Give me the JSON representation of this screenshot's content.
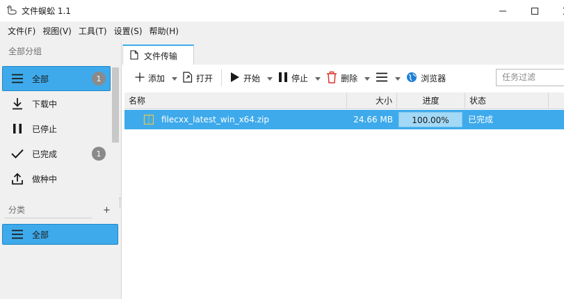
{
  "window": {
    "title": "文件蜈蚣 1.1"
  },
  "menu": [
    "文件(F)",
    "视图(V)",
    "工具(T)",
    "设置(S)",
    "帮助(H)"
  ],
  "sidebar": {
    "group_label": "全部分组",
    "items": [
      {
        "label": "全部",
        "icon": "list-icon",
        "badge": "1",
        "active": true
      },
      {
        "label": "下载中",
        "icon": "download-icon",
        "badge": "",
        "active": false
      },
      {
        "label": "已停止",
        "icon": "pause-icon",
        "badge": "",
        "active": false
      },
      {
        "label": "已完成",
        "icon": "check-icon",
        "badge": "1",
        "active": false
      },
      {
        "label": "做种中",
        "icon": "upload-icon",
        "badge": "",
        "active": false
      }
    ],
    "category_label": "分类",
    "category_add": "+",
    "categories": [
      {
        "label": "全部",
        "icon": "list-icon",
        "active": true
      }
    ]
  },
  "tabs": [
    {
      "label": "文件传输",
      "icon": "document-icon"
    }
  ],
  "toolbar": {
    "add": "添加",
    "open": "打开",
    "start": "开始",
    "stop": "停止",
    "delete": "删除",
    "browser": "浏览器",
    "filter_placeholder": "任务过滤"
  },
  "table": {
    "columns": [
      "名称",
      "大小",
      "进度",
      "状态"
    ],
    "rows": [
      {
        "name": "filecxx_latest_win_x64.zip",
        "size": "24.66 MB",
        "progress": "100.00%",
        "status": "已完成"
      }
    ]
  },
  "colors": {
    "accent": "#3eaaeb",
    "progress_fill": "#a3d9f6",
    "badge": "#8a8a8a",
    "delete_red": "#d9342b",
    "globe_blue": "#1f7fd6"
  }
}
